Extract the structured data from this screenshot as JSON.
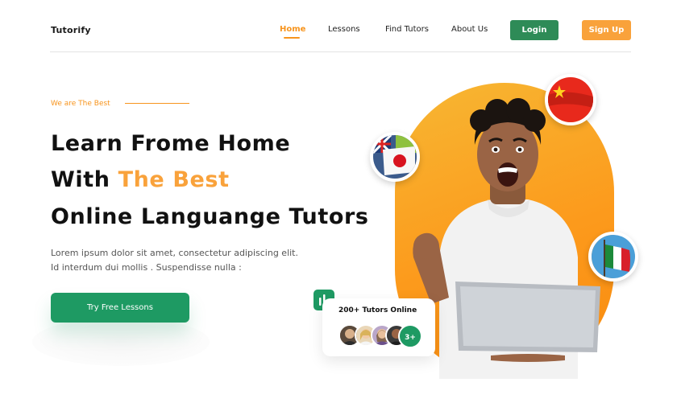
{
  "nav": {
    "brand": "Tutorify",
    "items": [
      {
        "label": "Home",
        "active": true
      },
      {
        "label": "Lessons",
        "active": false
      },
      {
        "label": "Find Tutors",
        "active": false
      },
      {
        "label": "About Us",
        "active": false
      }
    ],
    "login_label": "Login",
    "signup_label": "Sign Up"
  },
  "hero": {
    "tagline": "We are The Best",
    "headline_line1": "Learn Frome Home",
    "headline_line2_prefix": "With ",
    "headline_line2_accent": "The Best",
    "headline_line3": "Online Languange Tutors",
    "description_line1": "Lorem ipsum dolor sit amet, consectetur adipiscing elit.",
    "description_line2": "Id interdum dui mollis . Suspendisse nulla :",
    "cta_label": "Try Free Lessons"
  },
  "tutors_card": {
    "title": "200+ Tutors Online",
    "more_badge": "3+"
  },
  "colors": {
    "accent_orange": "#f9a23b",
    "primary_green": "#1e9a63",
    "login_green": "#2e8b57",
    "text_dark": "#111111"
  },
  "icons": [
    "stats-chart-icon",
    "china-flag-icon",
    "japan-flag-icon",
    "italy-flag-icon"
  ]
}
